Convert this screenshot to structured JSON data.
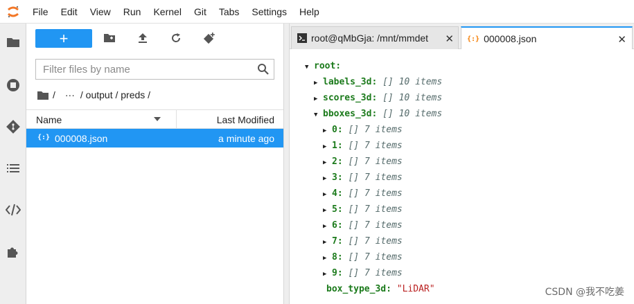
{
  "menubar": {
    "items": [
      "File",
      "Edit",
      "View",
      "Run",
      "Kernel",
      "Git",
      "Tabs",
      "Settings",
      "Help"
    ]
  },
  "activitybar": {
    "icons": [
      "folder-icon",
      "running-icon",
      "git-icon",
      "toc-icon",
      "property-inspector-icon",
      "extension-icon"
    ]
  },
  "filebrowser": {
    "new_label": "+",
    "filter_placeholder": "Filter files by name",
    "breadcrumbs": [
      "/",
      "···",
      "/ output / preds /"
    ],
    "columns": {
      "name": "Name",
      "modified": "Last Modified"
    },
    "files": [
      {
        "icon": "{:}",
        "name": "000008.json",
        "modified": "a minute ago"
      }
    ]
  },
  "tabs": [
    {
      "label": "root@qMbGja: /mnt/mmdet",
      "close": "✕"
    },
    {
      "label": "000008.json",
      "close": "✕"
    }
  ],
  "json_tree": {
    "root_label": "root:",
    "labels_3d": {
      "key": "labels_3d:",
      "meta": "[] 10 items"
    },
    "scores_3d": {
      "key": "scores_3d:",
      "meta": "[] 10 items"
    },
    "bboxes_3d": {
      "key": "bboxes_3d:",
      "meta": "[] 10 items"
    },
    "bbox_items": [
      {
        "key": "0:",
        "meta": "[] 7 items"
      },
      {
        "key": "1:",
        "meta": "[] 7 items"
      },
      {
        "key": "2:",
        "meta": "[] 7 items"
      },
      {
        "key": "3:",
        "meta": "[] 7 items"
      },
      {
        "key": "4:",
        "meta": "[] 7 items"
      },
      {
        "key": "5:",
        "meta": "[] 7 items"
      },
      {
        "key": "6:",
        "meta": "[] 7 items"
      },
      {
        "key": "7:",
        "meta": "[] 7 items"
      },
      {
        "key": "8:",
        "meta": "[] 7 items"
      },
      {
        "key": "9:",
        "meta": "[] 7 items"
      }
    ],
    "box_type": {
      "key": "box_type_3d:",
      "value": "\"LiDAR\""
    }
  },
  "watermark": "CSDN @我不吃姜",
  "colors": {
    "accent": "#2196f3",
    "json_key": "#1b7a1b",
    "json_string": "#ba2121"
  }
}
